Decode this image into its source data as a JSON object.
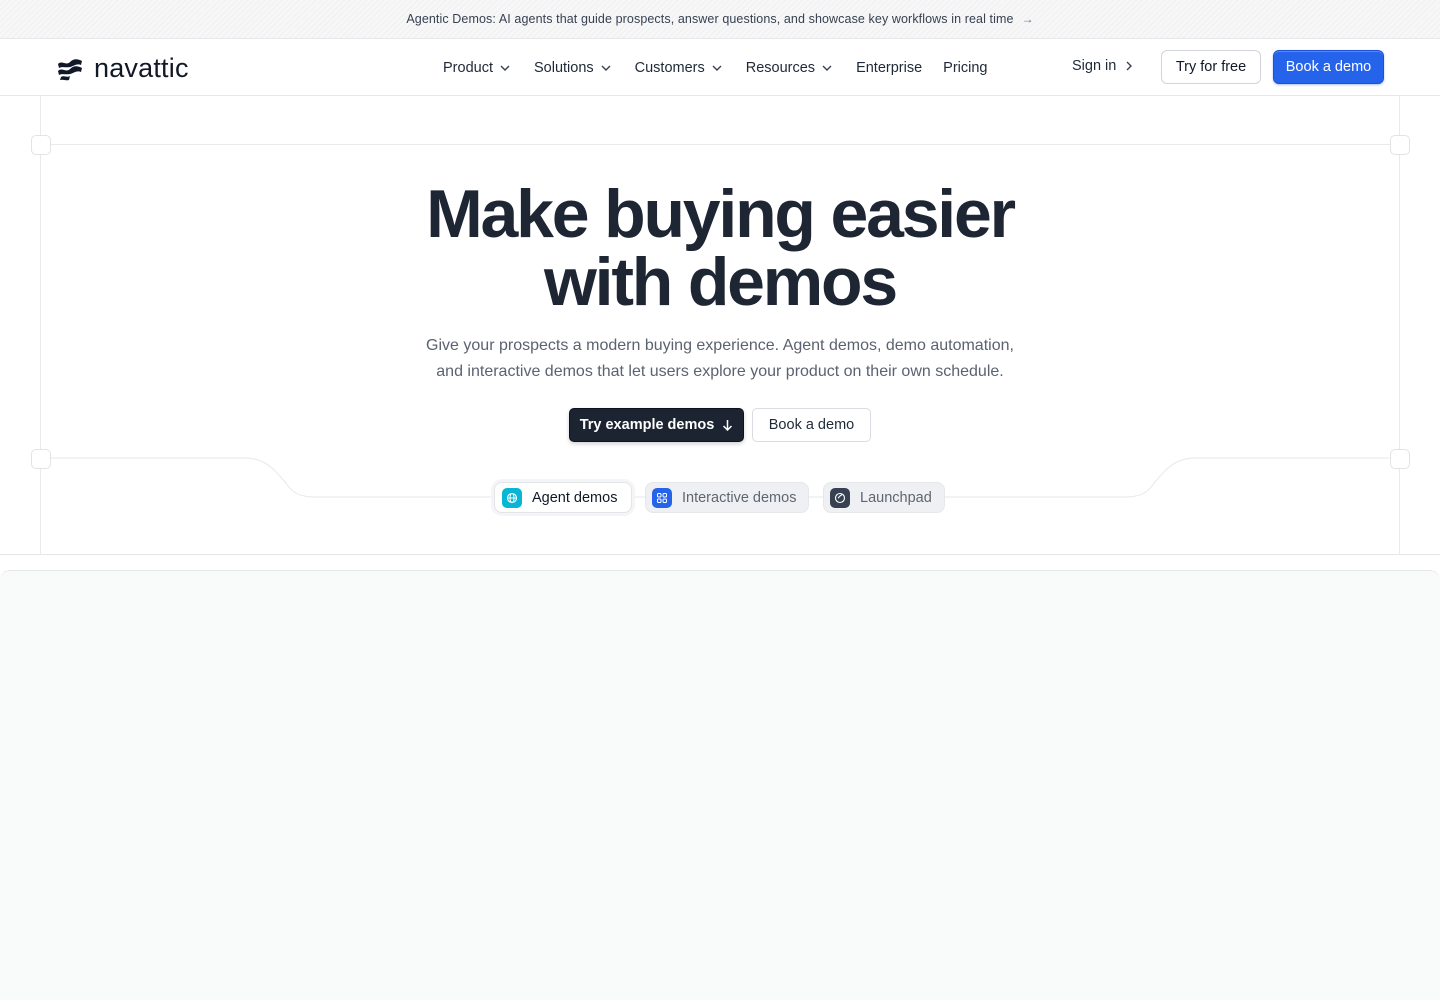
{
  "announcement": {
    "text": "Agentic Demos: AI agents that guide prospects, answer questions, and showcase key workflows in real time",
    "arrow_icon": "arrow-right-icon"
  },
  "header": {
    "brand": "navattic",
    "logo_icon": "navattic-logo-icon",
    "nav": [
      {
        "label": "Product",
        "has_dropdown": true
      },
      {
        "label": "Solutions",
        "has_dropdown": true
      },
      {
        "label": "Customers",
        "has_dropdown": true
      },
      {
        "label": "Resources",
        "has_dropdown": true
      },
      {
        "label": "Enterprise",
        "has_dropdown": false
      },
      {
        "label": "Pricing",
        "has_dropdown": false
      }
    ],
    "sign_in": "Sign in",
    "try_free": "Try for free",
    "book_demo": "Book a demo"
  },
  "hero": {
    "title_line1": "Make buying easier",
    "title_line2": "with demos",
    "subtitle_line1": "Give your prospects a modern buying experience. Agent demos, demo automation,",
    "subtitle_line2": "and interactive demos that let users explore your product on their own schedule.",
    "primary_cta": "Try example demos",
    "secondary_cta": "Book a demo"
  },
  "tabs": [
    {
      "label": "Agent demos",
      "active": true,
      "icon": "globe-icon",
      "color": "#06b6d4"
    },
    {
      "label": "Interactive demos",
      "active": false,
      "icon": "grid-icon",
      "color": "#2563eb"
    },
    {
      "label": "Launchpad",
      "active": false,
      "icon": "check-circle-icon",
      "color": "#374151"
    }
  ],
  "colors": {
    "accent": "#2563eb",
    "dark_button": "#1c2431",
    "heading": "#1e2533"
  }
}
